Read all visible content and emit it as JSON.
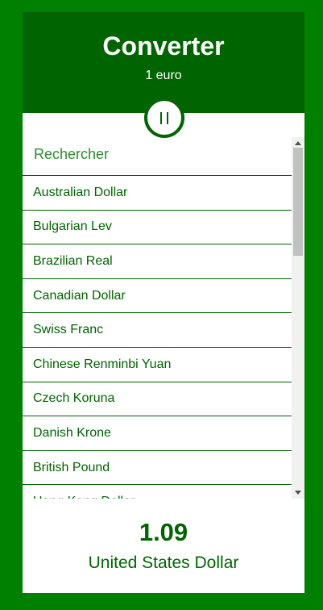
{
  "header": {
    "title": "Converter",
    "subtitle": "1 euro"
  },
  "pause_button": {
    "icon": "pause-icon"
  },
  "search": {
    "placeholder": "Rechercher"
  },
  "currencies": [
    "Australian Dollar",
    "Bulgarian Lev",
    "Brazilian Real",
    "Canadian Dollar",
    "Swiss Franc",
    "Chinese Renminbi Yuan",
    "Czech Koruna",
    "Danish Krone",
    "British Pound",
    "Hong Kong Dollar"
  ],
  "result": {
    "value": "1.09",
    "currency": "United States Dollar"
  },
  "colors": {
    "background": "#008000",
    "header": "#006400",
    "text": "#006400"
  }
}
